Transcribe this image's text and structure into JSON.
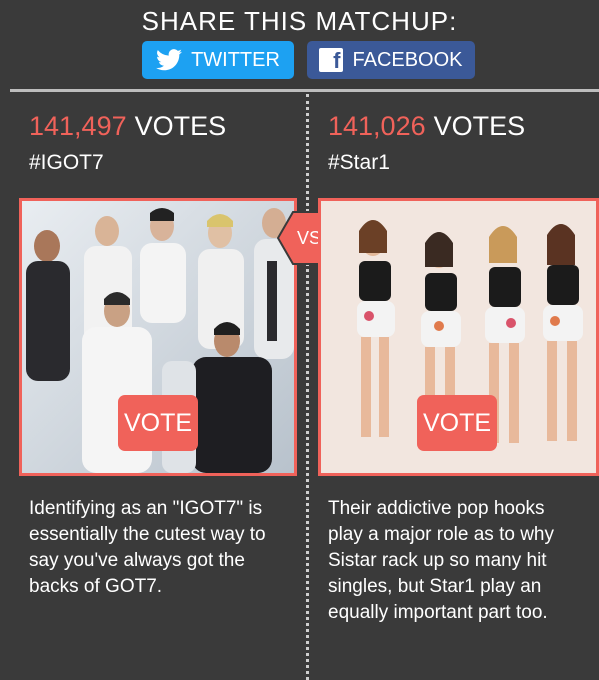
{
  "share": {
    "title": "SHARE THIS MATCHUP:",
    "twitter_label": "TWITTER",
    "facebook_label": "FACEBOOK"
  },
  "left": {
    "votes": "141,497",
    "votes_label": "VOTES",
    "hashtag": "#IGOT7",
    "vote_button": "VOTE",
    "description": "Identifying as an \"IGOT7\" is essentially the cutest way to say you've always got the backs of GOT7."
  },
  "right": {
    "votes": "141,026",
    "votes_label": "VOTES",
    "hashtag": "#Star1",
    "vote_button": "VOTE",
    "description": "Their addictive pop hooks play a major role as to why Sistar rack up so many hit singles, but Star1 play an equally important part too."
  },
  "vs_label": "VS",
  "colors": {
    "background": "#3a3a3a",
    "accent": "#f0625a",
    "twitter": "#1da1f2",
    "facebook": "#3b5998"
  }
}
